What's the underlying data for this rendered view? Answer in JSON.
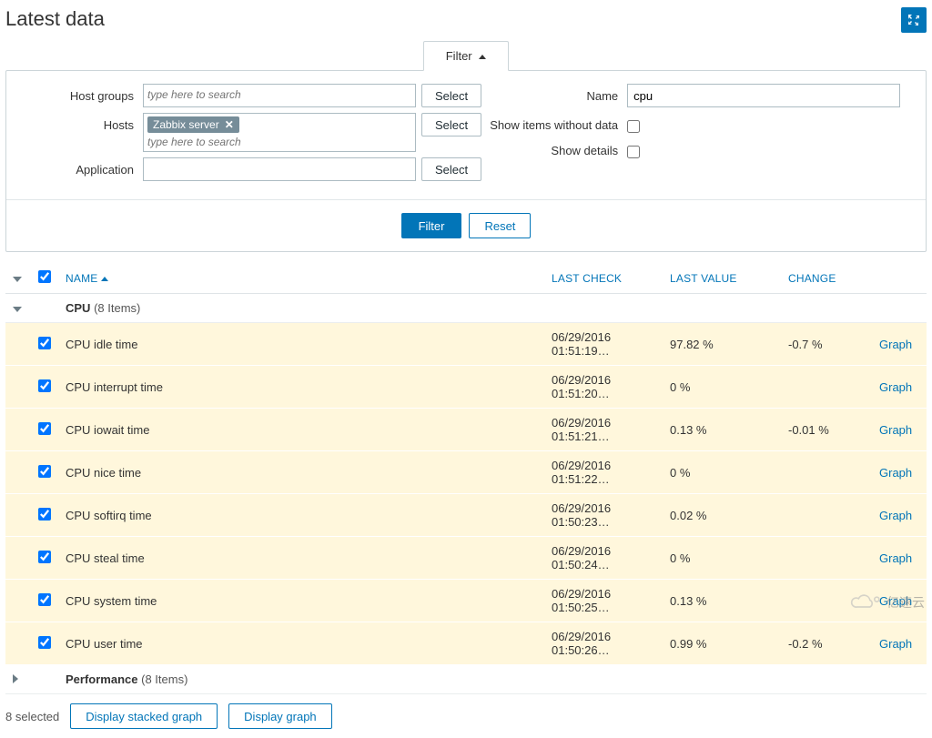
{
  "header": {
    "title": "Latest data"
  },
  "filter": {
    "tab_label": "Filter",
    "labels": {
      "host_groups": "Host groups",
      "hosts": "Hosts",
      "application": "Application",
      "name": "Name",
      "show_no_data": "Show items without data",
      "show_details": "Show details"
    },
    "placeholders": {
      "host_groups": "type here to search",
      "hosts": "type here to search"
    },
    "values": {
      "host_tag": "Zabbix server",
      "name": "cpu",
      "application": ""
    },
    "select_btn": "Select",
    "filter_btn": "Filter",
    "reset_btn": "Reset"
  },
  "table": {
    "headers": {
      "name": "NAME",
      "last_check": "LAST CHECK",
      "last_value": "LAST VALUE",
      "change": "CHANGE"
    },
    "groups": [
      {
        "name": "CPU",
        "count_label": "(8 Items)",
        "expanded": true,
        "items": [
          {
            "name": "CPU idle time",
            "last_check": "06/29/2016 01:51:19…",
            "last_value": "97.82 %",
            "change": "-0.7 %",
            "link": "Graph"
          },
          {
            "name": "CPU interrupt time",
            "last_check": "06/29/2016 01:51:20…",
            "last_value": "0 %",
            "change": "",
            "link": "Graph"
          },
          {
            "name": "CPU iowait time",
            "last_check": "06/29/2016 01:51:21…",
            "last_value": "0.13 %",
            "change": "-0.01 %",
            "link": "Graph"
          },
          {
            "name": "CPU nice time",
            "last_check": "06/29/2016 01:51:22…",
            "last_value": "0 %",
            "change": "",
            "link": "Graph"
          },
          {
            "name": "CPU softirq time",
            "last_check": "06/29/2016 01:50:23…",
            "last_value": "0.02 %",
            "change": "",
            "link": "Graph"
          },
          {
            "name": "CPU steal time",
            "last_check": "06/29/2016 01:50:24…",
            "last_value": "0 %",
            "change": "",
            "link": "Graph"
          },
          {
            "name": "CPU system time",
            "last_check": "06/29/2016 01:50:25…",
            "last_value": "0.13 %",
            "change": "",
            "link": "Graph"
          },
          {
            "name": "CPU user time",
            "last_check": "06/29/2016 01:50:26…",
            "last_value": "0.99 %",
            "change": "-0.2 %",
            "link": "Graph"
          }
        ]
      },
      {
        "name": "Performance",
        "count_label": "(8 Items)",
        "expanded": false,
        "items": []
      }
    ]
  },
  "footer": {
    "selected_text": "8 selected",
    "stacked_btn": "Display stacked graph",
    "graph_btn": "Display graph"
  },
  "watermark": "亿速云"
}
